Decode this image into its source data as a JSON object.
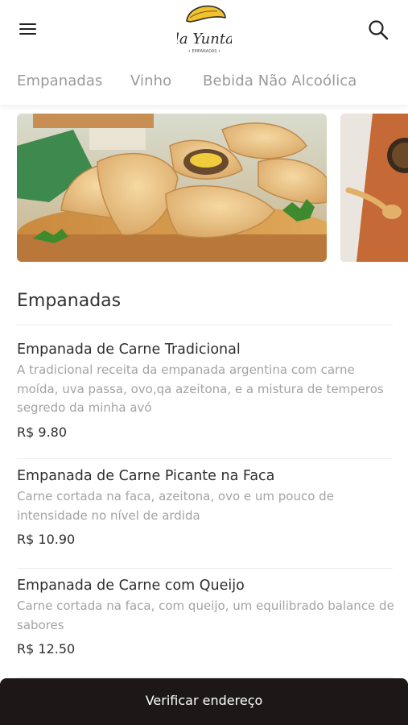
{
  "header": {
    "logo_text": "la Yunta",
    "logo_tagline": "• EMPANADAS •",
    "menu_icon": "hamburger-menu-icon",
    "search_icon": "search-icon"
  },
  "tabs": [
    {
      "label": "Empanadas"
    },
    {
      "label": "Vinho"
    },
    {
      "label": "Bebida Não Alcoólica"
    }
  ],
  "section": {
    "title": "Empanadas"
  },
  "items": [
    {
      "name": "Empanada de Carne Tradicional",
      "description": "A tradicional receita da empanada argentina com carne moída, uva passa, ovo,qa azeitona, e a mistura de temperos segredo da minha avó",
      "price": "R$ 9.80"
    },
    {
      "name": "Empanada de Carne Picante na Faca",
      "description": "Carne cortada na faca, azeitona, ovo e um pouco de intensidade no nível de ardida",
      "price": "R$ 10.90"
    },
    {
      "name": "Empanada de Carne com Queijo",
      "description": "Carne cortada na faca, com queijo, um equilibrado balance de sabores",
      "price": "R$ 12.50"
    }
  ],
  "bottom_bar": {
    "label": "Verificar endereço"
  },
  "colors": {
    "bottom_bar": "#1d1817",
    "tab_text": "#9a9a9a",
    "description_text": "#a3a3a3",
    "logo_yellow": "#f2c12e"
  }
}
